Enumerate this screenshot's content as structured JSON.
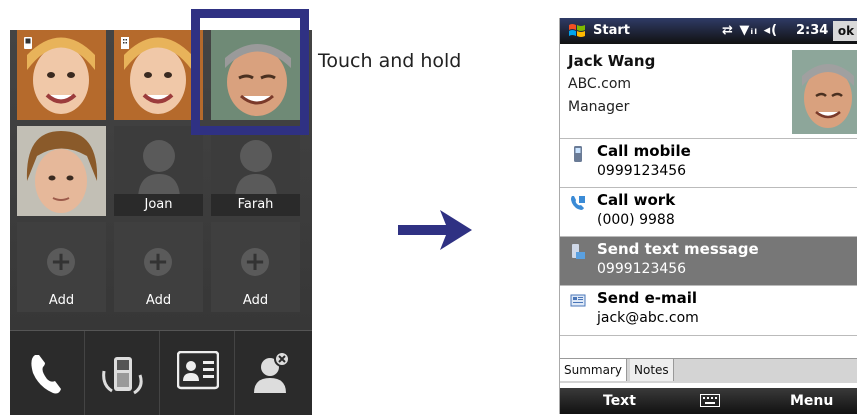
{
  "left": {
    "tiles": [
      {
        "name": ""
      },
      {
        "name": ""
      },
      {
        "name": ""
      },
      {
        "name": ""
      },
      {
        "name": "Joan"
      },
      {
        "name": "Farah"
      },
      {
        "name": "Add"
      },
      {
        "name": "Add"
      },
      {
        "name": "Add"
      }
    ],
    "touch_label": "Touch and hold",
    "bottom_buttons": [
      "phone-icon",
      "call-history-icon",
      "contact-card-icon",
      "remove-contact-icon"
    ]
  },
  "right": {
    "titlebar": {
      "start": "Start",
      "time": "2:34",
      "ok": "ok"
    },
    "contact": {
      "name": "Jack Wang",
      "company": "ABC.com",
      "title": "Manager"
    },
    "actions": [
      {
        "title": "Call mobile",
        "sub": "0999123456",
        "icon": "mobile-phone-icon"
      },
      {
        "title": "Call work",
        "sub": "(000) 9988",
        "icon": "work-phone-icon"
      },
      {
        "title": "Send text message",
        "sub": "0999123456",
        "icon": "sms-icon"
      },
      {
        "title": "Send e-mail",
        "sub": "jack@abc.com",
        "icon": "email-icon"
      }
    ],
    "tabs": [
      "Summary",
      "Notes"
    ],
    "softkeys": {
      "left": "Text",
      "right": "Menu"
    }
  },
  "colors": {
    "highlight": "#2f3183",
    "arrow": "#2f3183"
  }
}
